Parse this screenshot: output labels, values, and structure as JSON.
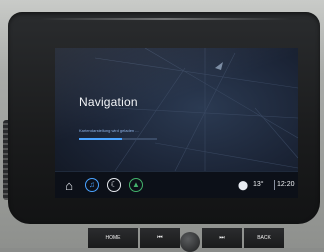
{
  "screen": {
    "title": "Navigation",
    "status_text": "Kartendarstellung wird geladen ...",
    "loading_progress": 0.55
  },
  "bottom_bar": {
    "icons": [
      "home-icon",
      "media-icon",
      "phone-icon",
      "nav-icon",
      "location-icon"
    ],
    "temperature": "13°",
    "time": "12:20"
  },
  "hard_buttons": {
    "home_label": "HOME",
    "prev_label": "⏮",
    "next_label": "⏭",
    "back_label": "BACK"
  },
  "colors": {
    "accent_blue": "#4aa3ff",
    "nav_green": "#43b26b"
  }
}
